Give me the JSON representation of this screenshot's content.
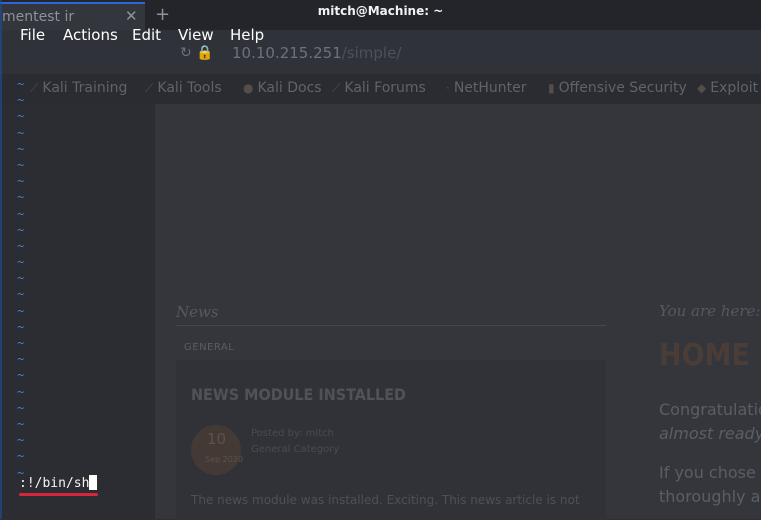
{
  "terminal": {
    "window_title": "mitch@Machine: ~",
    "menu": [
      "File",
      "Actions",
      "Edit",
      "View",
      "Help"
    ],
    "tilde_char": "~",
    "tilde_count": 25,
    "command": ":!/bin/sh",
    "cursor_color": "#ffffff",
    "annotation_color": "#d7263d"
  },
  "browser": {
    "tab_title": "mentest ir",
    "tab_close": "✕",
    "new_tab": "+",
    "url": "10.10.215.251",
    "url_suffix": "/simple/",
    "bookmarks": [
      "Kali Training",
      "Kali Tools",
      "Kali Docs",
      "Kali Forums",
      "NetHunter",
      "Offensive Security",
      "Exploit"
    ],
    "page": {
      "news_label": "News",
      "category": "GENERAL",
      "article_title": "NEWS MODULE INSTALLED",
      "date_day": "10",
      "date_month": "Sep 2020",
      "posted_by": "Posted by: mitch",
      "posted_category": "General Category",
      "article_body": "The news module was installed. Exciting. This news article is not",
      "breadcrumb": "You are here: H",
      "heading": "HOME",
      "side_text": [
        "Congratulatio",
        "almost ready",
        "If you chose t",
        "thoroughly as"
      ]
    }
  }
}
